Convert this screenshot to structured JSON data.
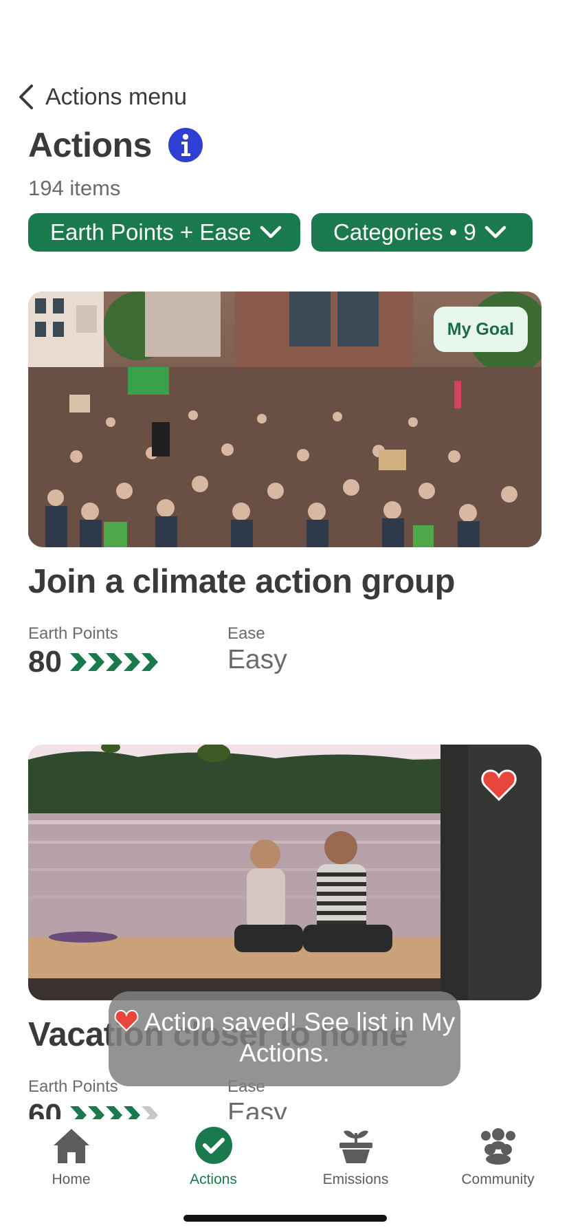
{
  "header": {
    "back_label": "Actions menu",
    "title": "Actions",
    "item_count": "194 items"
  },
  "filters": [
    {
      "label": "Earth Points + Ease"
    },
    {
      "label": "Categories • 9"
    }
  ],
  "cards": [
    {
      "title": "Join a climate action group",
      "badge": "My Goal",
      "points_label": "Earth Points",
      "points_value": "80",
      "points_level": 5,
      "points_max": 5,
      "ease_label": "Ease",
      "ease_value": "Easy",
      "image_icon": "crowd-photo"
    },
    {
      "title": "Vacation closer to home",
      "points_label": "Earth Points",
      "points_value": "60",
      "points_level": 4,
      "points_max": 5,
      "ease_label": "Ease",
      "ease_value": "Easy",
      "saved": true,
      "image_icon": "lake-couple-photo"
    }
  ],
  "toast": {
    "message": "Action saved! See list in My Actions."
  },
  "nav": [
    {
      "label": "Home",
      "icon": "home-icon",
      "active": false
    },
    {
      "label": "Actions",
      "icon": "check-circle-icon",
      "active": true
    },
    {
      "label": "Emissions",
      "icon": "sprout-pot-icon",
      "active": false
    },
    {
      "label": "Community",
      "icon": "people-group-icon",
      "active": false
    }
  ],
  "colors": {
    "accent": "#1b7a4d",
    "info": "#2f3fd3",
    "heart": "#e8453c",
    "badge_bg": "#e7f7ee"
  }
}
